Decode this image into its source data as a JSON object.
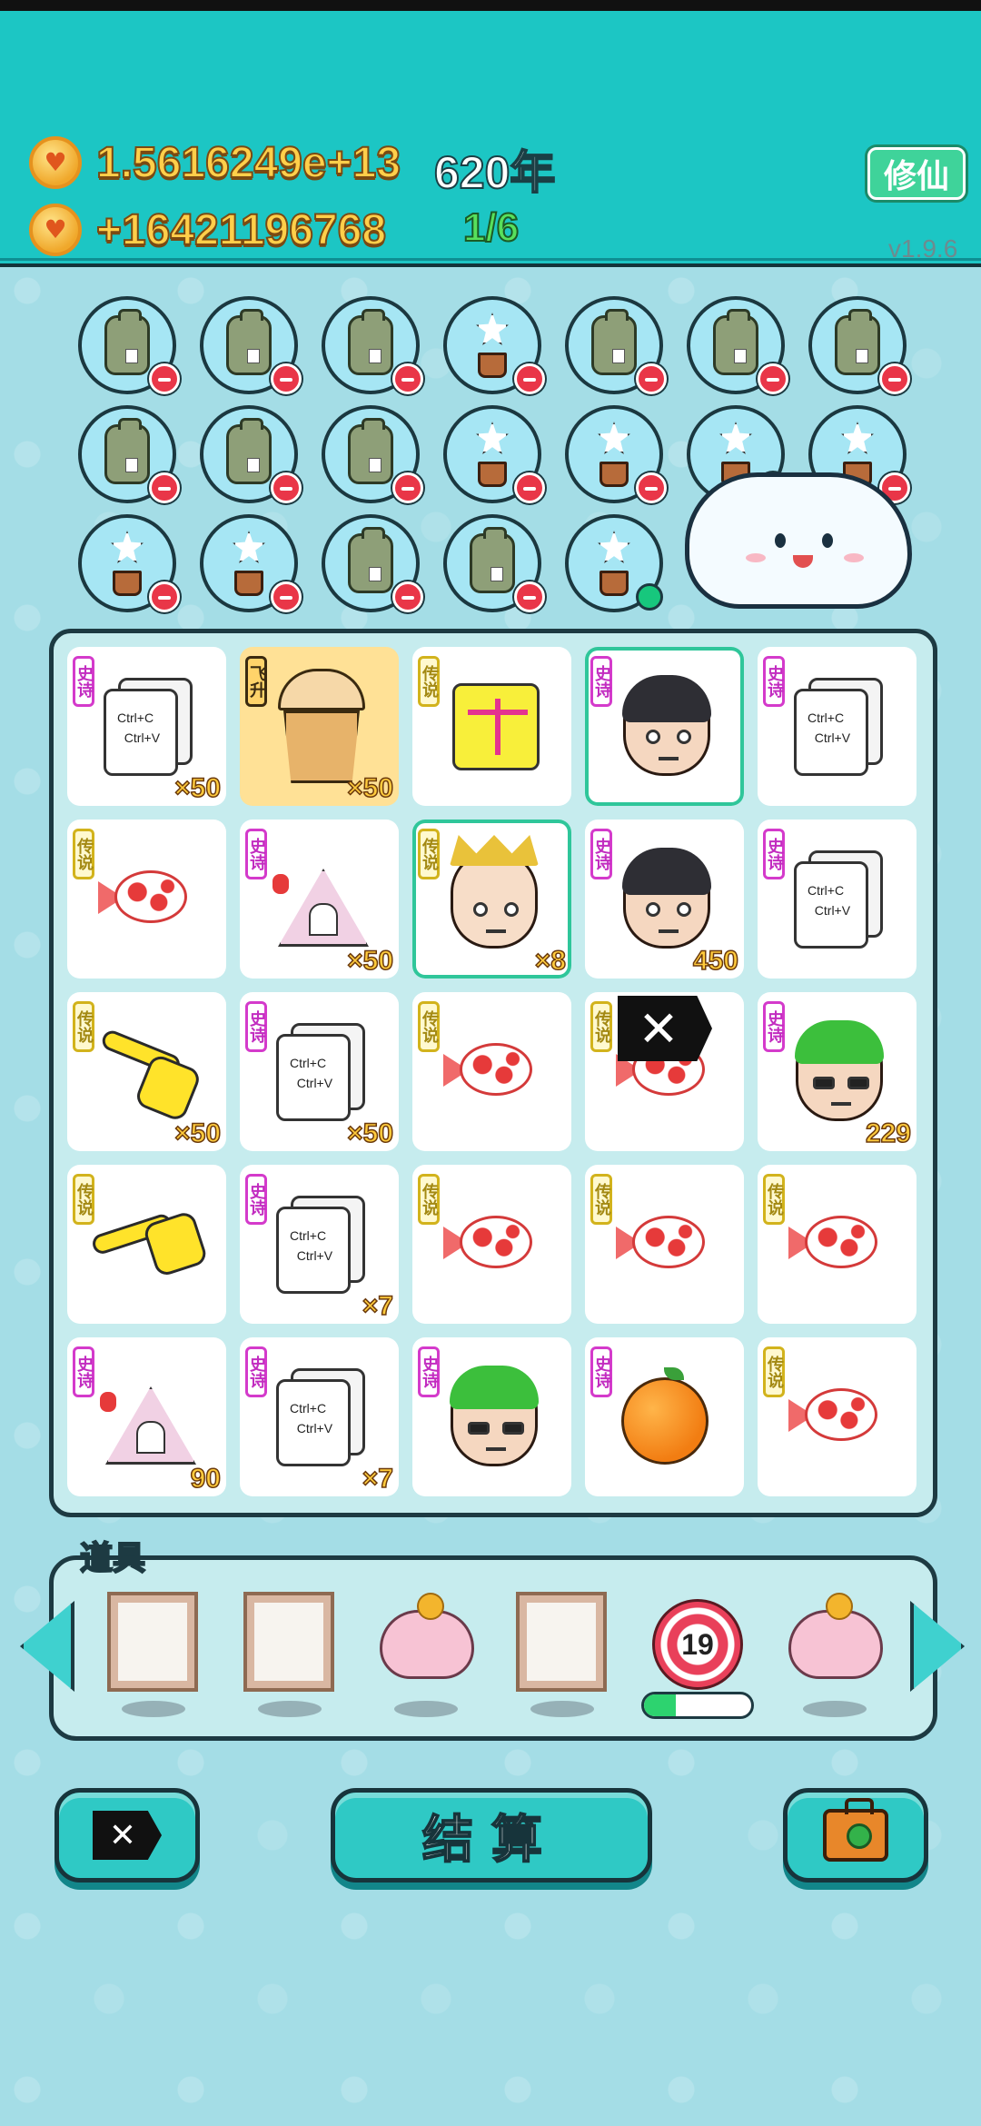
{
  "header": {
    "coins_total": "1.5616249e+13",
    "years": "620年",
    "coins_income": "+16421196768",
    "round": "1/6",
    "xiuxian_label": "修仙",
    "version": "v1.9.6"
  },
  "tags": {
    "epic": "史诗",
    "legend": "传说",
    "fly": "飞升"
  },
  "board": {
    "cells": [
      {
        "tag": "史诗",
        "item": "copy-paste",
        "count": "×50"
      },
      {
        "tag": "飞升",
        "item": "milk-tea",
        "count": "×50"
      },
      {
        "tag": "传说",
        "item": "scale",
        "count": ""
      },
      {
        "tag": "史诗",
        "item": "face-man",
        "count": ""
      },
      {
        "tag": "史诗",
        "item": "copy-paste",
        "count": ""
      },
      {
        "tag": "传说",
        "item": "koi-fish",
        "count": ""
      },
      {
        "tag": "史诗",
        "item": "rabbit-house",
        "count": "×50"
      },
      {
        "tag": "传说",
        "item": "king-face",
        "count": "×8"
      },
      {
        "tag": "史诗",
        "item": "face-man",
        "count": "450"
      },
      {
        "tag": "史诗",
        "item": "copy-paste",
        "count": ""
      },
      {
        "tag": "传说",
        "item": "hand-point",
        "count": "×50"
      },
      {
        "tag": "史诗",
        "item": "copy-paste",
        "count": "×50"
      },
      {
        "tag": "传说",
        "item": "koi-fish",
        "count": ""
      },
      {
        "tag": "传说",
        "item": "koi-fish",
        "count": ""
      },
      {
        "tag": "史诗",
        "item": "cap-face",
        "count": "229"
      },
      {
        "tag": "传说",
        "item": "hand-point",
        "count": ""
      },
      {
        "tag": "史诗",
        "item": "copy-paste",
        "count": "×7"
      },
      {
        "tag": "传说",
        "item": "koi-fish",
        "count": ""
      },
      {
        "tag": "传说",
        "item": "koi-fish",
        "count": ""
      },
      {
        "tag": "传说",
        "item": "koi-fish",
        "count": ""
      },
      {
        "tag": "史诗",
        "item": "rabbit-house",
        "count": "90"
      },
      {
        "tag": "史诗",
        "item": "copy-paste",
        "count": "×7"
      },
      {
        "tag": "史诗",
        "item": "cap-face",
        "count": ""
      },
      {
        "tag": "史诗",
        "item": "orange",
        "count": ""
      },
      {
        "tag": "传说",
        "item": "koi-fish",
        "count": ""
      }
    ],
    "copy_text": "Ctrl+C\n  Ctrl+V"
  },
  "items": {
    "title": "道具",
    "target_value": "19",
    "target_progress": 0.3
  },
  "buttons": {
    "settle": "结算"
  },
  "colors": {
    "header_bg": "#1cc6c4",
    "page_bg": "#a4dde6",
    "epic_tag": "#d43acb",
    "legend_tag": "#d2b31c"
  }
}
